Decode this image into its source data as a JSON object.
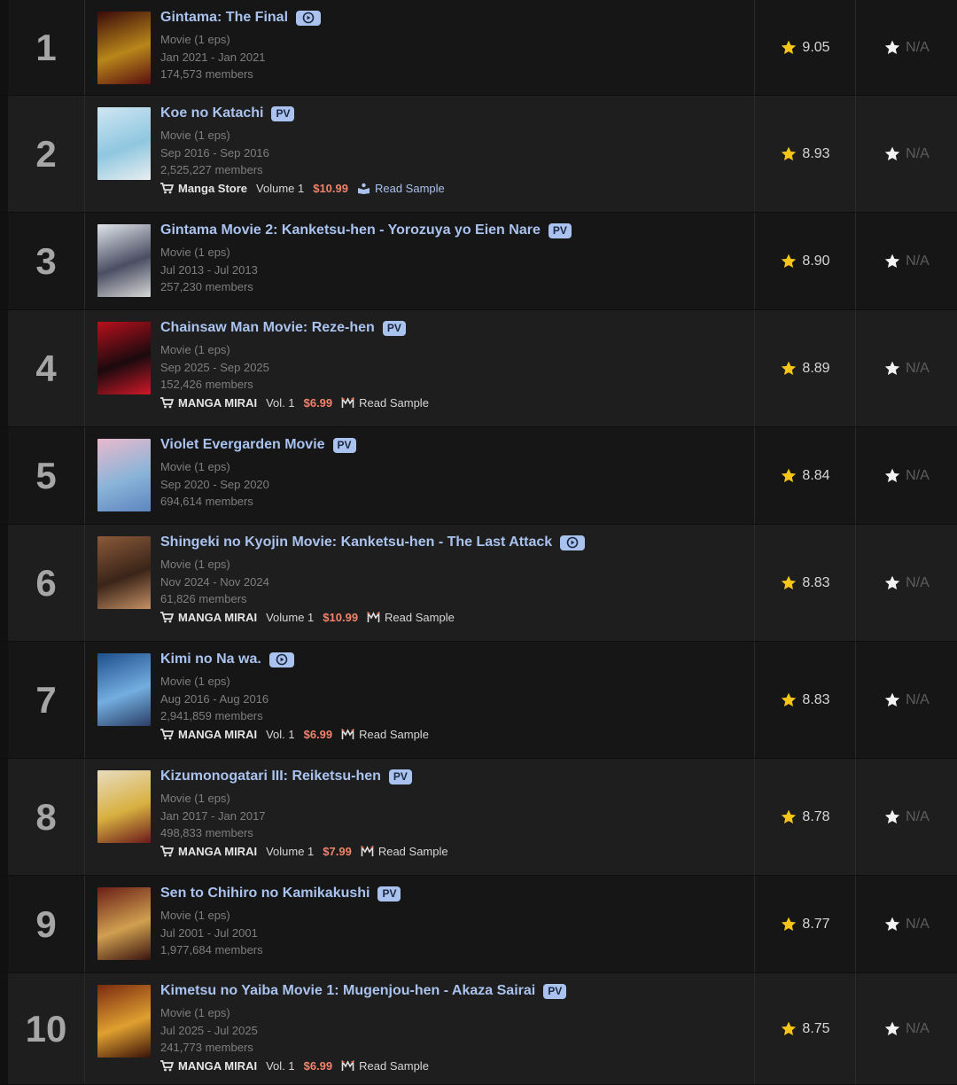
{
  "colors": {
    "title": "#a9c2ee",
    "badge_bg": "#a9c2ee",
    "price": "#f2826b",
    "score_star": "#f5c518",
    "meta": "#7e7e7e"
  },
  "rows": [
    {
      "rank": "1",
      "title": "Gintama: The Final",
      "badge": "play",
      "badge_label": "",
      "type": "Movie (1 eps)",
      "dates": "Jan 2021 - Jan 2021",
      "members": "174,573 members",
      "manga": null,
      "score": "9.05",
      "user_score": "N/A",
      "poster": [
        "#3a0a0a",
        "#b8861a",
        "#5a1010"
      ]
    },
    {
      "rank": "2",
      "title": "Koe no Katachi",
      "badge": "pv",
      "badge_label": "PV",
      "type": "Movie (1 eps)",
      "dates": "Sep 2016 - Sep 2016",
      "members": "2,525,227 members",
      "manga": {
        "store": "Manga Store",
        "volume": "Volume 1",
        "price": "$10.99",
        "sample": "Read Sample",
        "style": "store"
      },
      "score": "8.93",
      "user_score": "N/A",
      "poster": [
        "#cfe6f2",
        "#8fc7e0",
        "#e8eef0"
      ]
    },
    {
      "rank": "3",
      "title": "Gintama Movie 2: Kanketsu-hen - Yorozuya yo Eien Nare",
      "badge": "pv",
      "badge_label": "PV",
      "type": "Movie (1 eps)",
      "dates": "Jul 2013 - Jul 2013",
      "members": "257,230 members",
      "manga": null,
      "score": "8.90",
      "user_score": "N/A",
      "poster": [
        "#dfe4ea",
        "#4a4e62",
        "#d8d8d8"
      ]
    },
    {
      "rank": "4",
      "title": "Chainsaw Man Movie: Reze-hen",
      "badge": "pv",
      "badge_label": "PV",
      "type": "Movie (1 eps)",
      "dates": "Sep 2025 - Sep 2025",
      "members": "152,426 members",
      "manga": {
        "store": "MANGA MIRAI",
        "volume": "Vol. 1",
        "price": "$6.99",
        "sample": "Read Sample",
        "style": "mirai"
      },
      "score": "8.89",
      "user_score": "N/A",
      "poster": [
        "#b8101c",
        "#1a0a0e",
        "#d01828"
      ]
    },
    {
      "rank": "5",
      "title": "Violet Evergarden Movie",
      "badge": "pv",
      "badge_label": "PV",
      "type": "Movie (1 eps)",
      "dates": "Sep 2020 - Sep 2020",
      "members": "694,614 members",
      "manga": null,
      "score": "8.84",
      "user_score": "N/A",
      "poster": [
        "#e9b9cc",
        "#8ab4d8",
        "#5d86c0"
      ]
    },
    {
      "rank": "6",
      "title": "Shingeki no Kyojin Movie: Kanketsu-hen - The Last Attack",
      "badge": "play",
      "badge_label": "",
      "type": "Movie (1 eps)",
      "dates": "Nov 2024 - Nov 2024",
      "members": "61,826 members",
      "manga": {
        "store": "MANGA MIRAI",
        "volume": "Volume 1",
        "price": "$10.99",
        "sample": "Read Sample",
        "style": "mirai"
      },
      "score": "8.83",
      "user_score": "N/A",
      "poster": [
        "#8a5a3a",
        "#3a2418",
        "#c49064"
      ]
    },
    {
      "rank": "7",
      "title": "Kimi no Na wa.",
      "badge": "play",
      "badge_label": "",
      "type": "Movie (1 eps)",
      "dates": "Aug 2016 - Aug 2016",
      "members": "2,941,859 members",
      "manga": {
        "store": "MANGA MIRAI",
        "volume": "Vol. 1",
        "price": "$6.99",
        "sample": "Read Sample",
        "style": "mirai"
      },
      "score": "8.83",
      "user_score": "N/A",
      "poster": [
        "#1e4f8c",
        "#73aee0",
        "#2a3e66"
      ]
    },
    {
      "rank": "8",
      "title": "Kizumonogatari III: Reiketsu-hen",
      "badge": "pv",
      "badge_label": "PV",
      "type": "Movie (1 eps)",
      "dates": "Jan 2017 - Jan 2017",
      "members": "498,833 members",
      "manga": {
        "store": "MANGA MIRAI",
        "volume": "Volume 1",
        "price": "$7.99",
        "sample": "Read Sample",
        "style": "mirai"
      },
      "score": "8.78",
      "user_score": "N/A",
      "poster": [
        "#e8dcc0",
        "#d8b040",
        "#6a1a1a"
      ]
    },
    {
      "rank": "9",
      "title": "Sen to Chihiro no Kamikakushi",
      "badge": "pv",
      "badge_label": "PV",
      "type": "Movie (1 eps)",
      "dates": "Jul 2001 - Jul 2001",
      "members": "1,977,684 members",
      "manga": null,
      "score": "8.77",
      "user_score": "N/A",
      "poster": [
        "#6a1e16",
        "#d0a050",
        "#3a140e"
      ]
    },
    {
      "rank": "10",
      "title": "Kimetsu no Yaiba Movie 1: Mugenjou-hen - Akaza Sairai",
      "badge": "pv",
      "badge_label": "PV",
      "type": "Movie (1 eps)",
      "dates": "Jul 2025 - Jul 2025",
      "members": "241,773 members",
      "manga": {
        "store": "MANGA MIRAI",
        "volume": "Vol. 1",
        "price": "$6.99",
        "sample": "Read Sample",
        "style": "mirai"
      },
      "score": "8.75",
      "user_score": "N/A",
      "poster": [
        "#7a2a10",
        "#e0a030",
        "#3a1208"
      ]
    }
  ]
}
